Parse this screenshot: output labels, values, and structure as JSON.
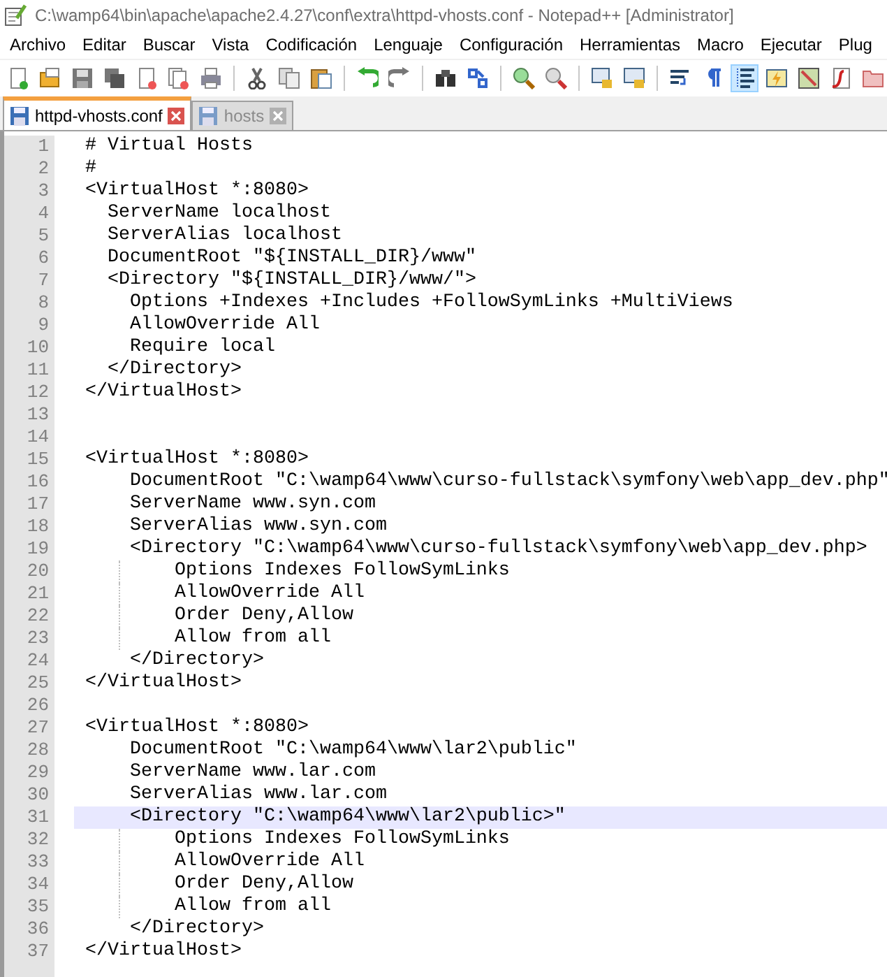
{
  "window": {
    "title": "C:\\wamp64\\bin\\apache\\apache2.4.27\\conf\\extra\\httpd-vhosts.conf - Notepad++ [Administrator]"
  },
  "menu": [
    "Archivo",
    "Editar",
    "Buscar",
    "Vista",
    "Codificación",
    "Lenguaje",
    "Configuración",
    "Herramientas",
    "Macro",
    "Ejecutar",
    "Plug"
  ],
  "toolbar": [
    {
      "kind": "new",
      "pressed": false
    },
    {
      "kind": "open",
      "pressed": false
    },
    {
      "kind": "save",
      "pressed": false
    },
    {
      "kind": "save-all",
      "pressed": false
    },
    {
      "kind": "close",
      "pressed": false
    },
    {
      "kind": "close-all",
      "pressed": false
    },
    {
      "kind": "print",
      "pressed": false
    },
    {
      "kind": "sep"
    },
    {
      "kind": "cut",
      "pressed": false
    },
    {
      "kind": "copy",
      "pressed": false
    },
    {
      "kind": "paste",
      "pressed": false
    },
    {
      "kind": "sep"
    },
    {
      "kind": "undo",
      "pressed": false
    },
    {
      "kind": "redo",
      "pressed": false
    },
    {
      "kind": "sep"
    },
    {
      "kind": "find",
      "pressed": false
    },
    {
      "kind": "replace",
      "pressed": false
    },
    {
      "kind": "sep"
    },
    {
      "kind": "zoom-in",
      "pressed": false
    },
    {
      "kind": "zoom-out",
      "pressed": false
    },
    {
      "kind": "sep"
    },
    {
      "kind": "sync-v",
      "pressed": false
    },
    {
      "kind": "sync-h",
      "pressed": false
    },
    {
      "kind": "sep"
    },
    {
      "kind": "wrap",
      "pressed": false
    },
    {
      "kind": "all-chars",
      "pressed": false
    },
    {
      "kind": "indent-guide",
      "pressed": true
    },
    {
      "kind": "lang",
      "pressed": false
    },
    {
      "kind": "map",
      "pressed": false
    },
    {
      "kind": "function",
      "pressed": false
    },
    {
      "kind": "folder",
      "pressed": false
    }
  ],
  "tabs": [
    {
      "label": "httpd-vhosts.conf",
      "selected": true
    },
    {
      "label": "hosts",
      "selected": false
    }
  ],
  "editor": {
    "lines": [
      {
        "number": "1",
        "text": "# Virtual Hosts",
        "current": false
      },
      {
        "number": "2",
        "text": "#",
        "current": false
      },
      {
        "number": "3",
        "text": "<VirtualHost *:8080>",
        "current": false
      },
      {
        "number": "4",
        "text": "  ServerName localhost",
        "current": false
      },
      {
        "number": "5",
        "text": "  ServerAlias localhost",
        "current": false
      },
      {
        "number": "6",
        "text": "  DocumentRoot \"${INSTALL_DIR}/www\"",
        "current": false
      },
      {
        "number": "7",
        "text": "  <Directory \"${INSTALL_DIR}/www/\">",
        "current": false
      },
      {
        "number": "8",
        "text": "    Options +Indexes +Includes +FollowSymLinks +MultiViews",
        "current": false
      },
      {
        "number": "9",
        "text": "    AllowOverride All",
        "current": false
      },
      {
        "number": "10",
        "text": "    Require local",
        "current": false
      },
      {
        "number": "11",
        "text": "  </Directory>",
        "current": false
      },
      {
        "number": "12",
        "text": "</VirtualHost>",
        "current": false
      },
      {
        "number": "13",
        "current": false
      },
      {
        "number": "14",
        "current": false
      },
      {
        "number": "15",
        "text": "<VirtualHost *:8080>",
        "current": false
      },
      {
        "number": "16",
        "text": "    DocumentRoot \"C:\\wamp64\\www\\curso-fullstack\\symfony\\web\\app_dev.php\"",
        "current": false
      },
      {
        "number": "17",
        "text": "    ServerName www.syn.com",
        "current": false
      },
      {
        "number": "18",
        "text": "    ServerAlias www.syn.com",
        "current": false
      },
      {
        "number": "19",
        "text": "    <Directory \"C:\\wamp64\\www\\curso-fullstack\\symfony\\web\\app_dev.php>",
        "current": false
      },
      {
        "number": "20",
        "text": "        Options Indexes FollowSymLinks",
        "current": false
      },
      {
        "number": "21",
        "text": "        AllowOverride All",
        "current": false
      },
      {
        "number": "22",
        "text": "        Order Deny,Allow",
        "current": false
      },
      {
        "number": "23",
        "text": "        Allow from all",
        "current": false
      },
      {
        "number": "24",
        "text": "    </Directory>",
        "current": false
      },
      {
        "number": "25",
        "text": "</VirtualHost>",
        "current": false
      },
      {
        "number": "26",
        "current": false
      },
      {
        "number": "27",
        "text": "<VirtualHost *:8080>",
        "current": false
      },
      {
        "number": "28",
        "text": "    DocumentRoot \"C:\\wamp64\\www\\lar2\\public\"",
        "current": false
      },
      {
        "number": "29",
        "text": "    ServerName www.lar.com",
        "current": false
      },
      {
        "number": "30",
        "text": "    ServerAlias www.lar.com",
        "current": false
      },
      {
        "number": "31",
        "text": "    <Directory \"C:\\wamp64\\www\\lar2\\public>\"",
        "current": true
      },
      {
        "number": "32",
        "text": "        Options Indexes FollowSymLinks",
        "current": false
      },
      {
        "number": "33",
        "text": "        AllowOverride All",
        "current": false
      },
      {
        "number": "34",
        "text": "        Order Deny,Allow",
        "current": false
      },
      {
        "number": "35",
        "text": "        Allow from all",
        "current": false
      },
      {
        "number": "36",
        "text": "    </Directory>",
        "current": false
      },
      {
        "number": "37",
        "text": "</VirtualHost>",
        "current": false
      }
    ]
  }
}
